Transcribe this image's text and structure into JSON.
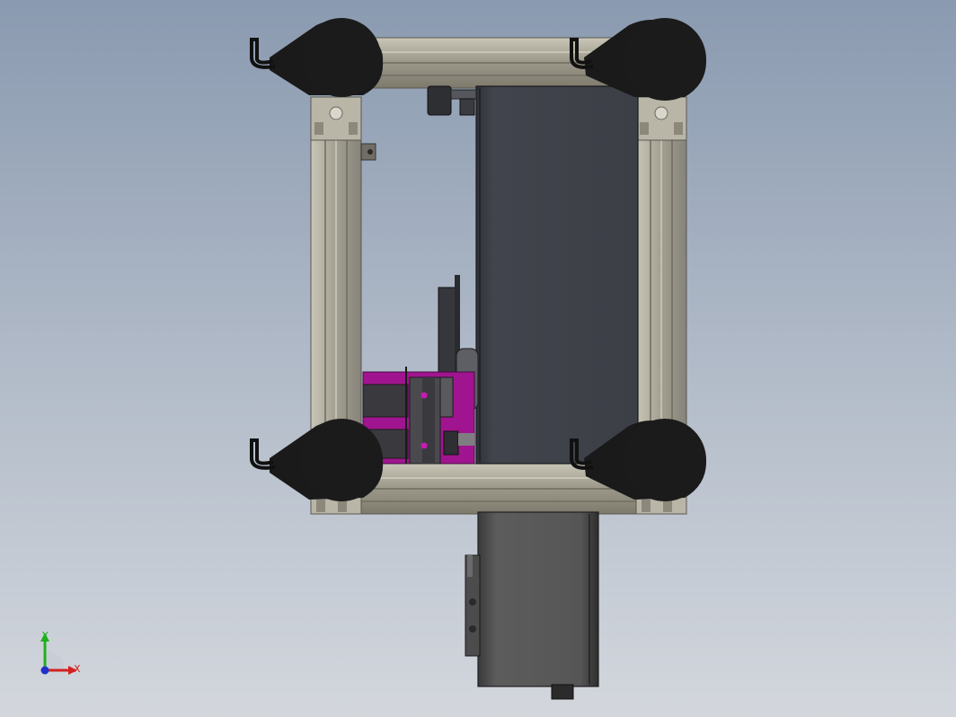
{
  "viewport": {
    "background_top": "#8a9ab0",
    "background_bottom": "#d3d7dd"
  },
  "triad": {
    "x_label": "X",
    "y_label": "Y",
    "x_color": "#d42020",
    "y_color": "#20b020",
    "z_color": "#2030c8"
  },
  "model": {
    "frame_color": "#a8a596",
    "caster_color": "#1a1a1a",
    "panel_color": "#3e4149",
    "motor_color": "#5a5a5a",
    "accent_color": "#a0158f"
  }
}
